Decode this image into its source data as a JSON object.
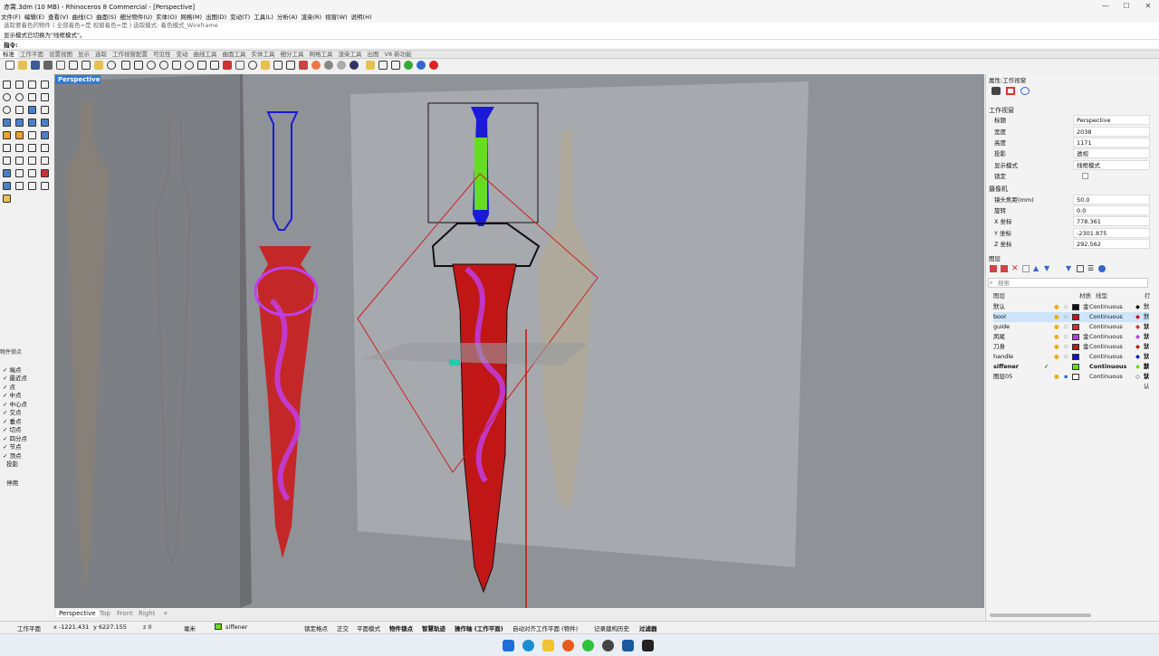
{
  "app": {
    "title": "赤霄.3dm (10 MB) - Rhinoceros 8 Commercial - [Perspective]",
    "minimize": "—",
    "maximize": "☐",
    "close": "✕"
  },
  "menu": [
    "文件(F)",
    "编辑(E)",
    "查看(V)",
    "曲线(C)",
    "曲面(S)",
    "细分物件(U)",
    "实体(O)",
    "网格(M)",
    "出图(D)",
    "变动(T)",
    "工具(L)",
    "分析(A)",
    "渲染(R)",
    "视窗(W)",
    "说明(H)"
  ],
  "command": {
    "history_line1": "选取要着色的物件 ( 全部着色=是 视窗着色=是 ) 选取模式: 着色模式_Wireframe",
    "history_line2": "显示模式已切换为\"线框模式\"。",
    "prompt": "指令:"
  },
  "toolbar_tabs": [
    "标准",
    "工作平面",
    "设置视图",
    "显示",
    "选取",
    "工作视窗配置",
    "可见性",
    "变动",
    "曲线工具",
    "曲面工具",
    "实体工具",
    "细分工具",
    "网格工具",
    "渲染工具",
    "出图",
    "V8 新功能"
  ],
  "osnap": {
    "title": "物件锁点",
    "items": [
      {
        "label": "端点",
        "checked": true
      },
      {
        "label": "最近点",
        "checked": true
      },
      {
        "label": "点",
        "checked": true
      },
      {
        "label": "中点",
        "checked": true
      },
      {
        "label": "中心点",
        "checked": true
      },
      {
        "label": "交点",
        "checked": true
      },
      {
        "label": "垂点",
        "checked": true
      },
      {
        "label": "切点",
        "checked": true
      },
      {
        "label": "四分点",
        "checked": true
      },
      {
        "label": "节点",
        "checked": true
      },
      {
        "label": "顶点",
        "checked": true
      },
      {
        "label": "投影",
        "checked": false
      }
    ],
    "disable": "停用"
  },
  "viewport": {
    "title": "Perspective",
    "tabs": [
      "Perspective",
      "Top",
      "Front",
      "Right"
    ],
    "add": "+"
  },
  "properties": {
    "header": "属性:工作视窗",
    "section_viewport": "工作视窗",
    "rows": [
      {
        "k": "标题",
        "v": "Perspective"
      },
      {
        "k": "宽度",
        "v": "2038"
      },
      {
        "k": "高度",
        "v": "1171"
      },
      {
        "k": "投影",
        "v": "透视"
      },
      {
        "k": "显示模式",
        "v": "线框模式"
      },
      {
        "k": "锁定",
        "v": ""
      }
    ],
    "section_camera": "摄像机",
    "camera_rows": [
      {
        "k": "镜头焦距(mm)",
        "v": "50.0"
      },
      {
        "k": "旋转",
        "v": "0.0"
      },
      {
        "k": "X 坐标",
        "v": "778.361"
      },
      {
        "k": "Y 坐标",
        "v": "-2301.875"
      },
      {
        "k": "Z 坐标",
        "v": "292.562"
      }
    ]
  },
  "layers": {
    "header": "图层",
    "search_placeholder": "搜索",
    "columns": {
      "name": "图层",
      "material": "材质",
      "linetype": "线型",
      "print": "打"
    },
    "rows": [
      {
        "name": "默认",
        "color": "#111111",
        "linetype": "Continuous",
        "mat": "金",
        "print": "默认"
      },
      {
        "name": "bool",
        "color": "#d01010",
        "linetype": "Continuous",
        "mat": "",
        "print": "默认",
        "selected": true
      },
      {
        "name": "guide",
        "color": "#d03030",
        "linetype": "Continuous",
        "mat": "",
        "print": "默认"
      },
      {
        "name": "凤尾",
        "color": "#b040e0",
        "linetype": "Continuous",
        "mat": "金",
        "print": "默认"
      },
      {
        "name": "刀身",
        "color": "#c01818",
        "linetype": "Continuous",
        "mat": "金",
        "print": "默认"
      },
      {
        "name": "handle",
        "color": "#1010d0",
        "linetype": "Continuous",
        "mat": "",
        "print": "默认"
      },
      {
        "name": "siffener",
        "color": "#66dd22",
        "linetype": "Continuous",
        "mat": "",
        "print": "默认",
        "current": true
      },
      {
        "name": "图层05",
        "color": "#ffffff",
        "linetype": "Continuous",
        "mat": "",
        "print": "默认"
      }
    ]
  },
  "status": {
    "cplane": "工作平面",
    "x": "x -1221.431",
    "y": "y 6227.155",
    "z": "z 0",
    "unit": "毫米",
    "layer": "siffener",
    "toggles": [
      "锁定格点",
      "正交",
      "平面模式",
      "物件锁点",
      "智慧轨迹",
      "操作轴 (工作平面)",
      "自动对齐工作平面 (物件)",
      "记录建构历史",
      "过滤器"
    ]
  },
  "colors": {
    "accent": "#2f7bd6",
    "layer_current": "#66dd22"
  }
}
